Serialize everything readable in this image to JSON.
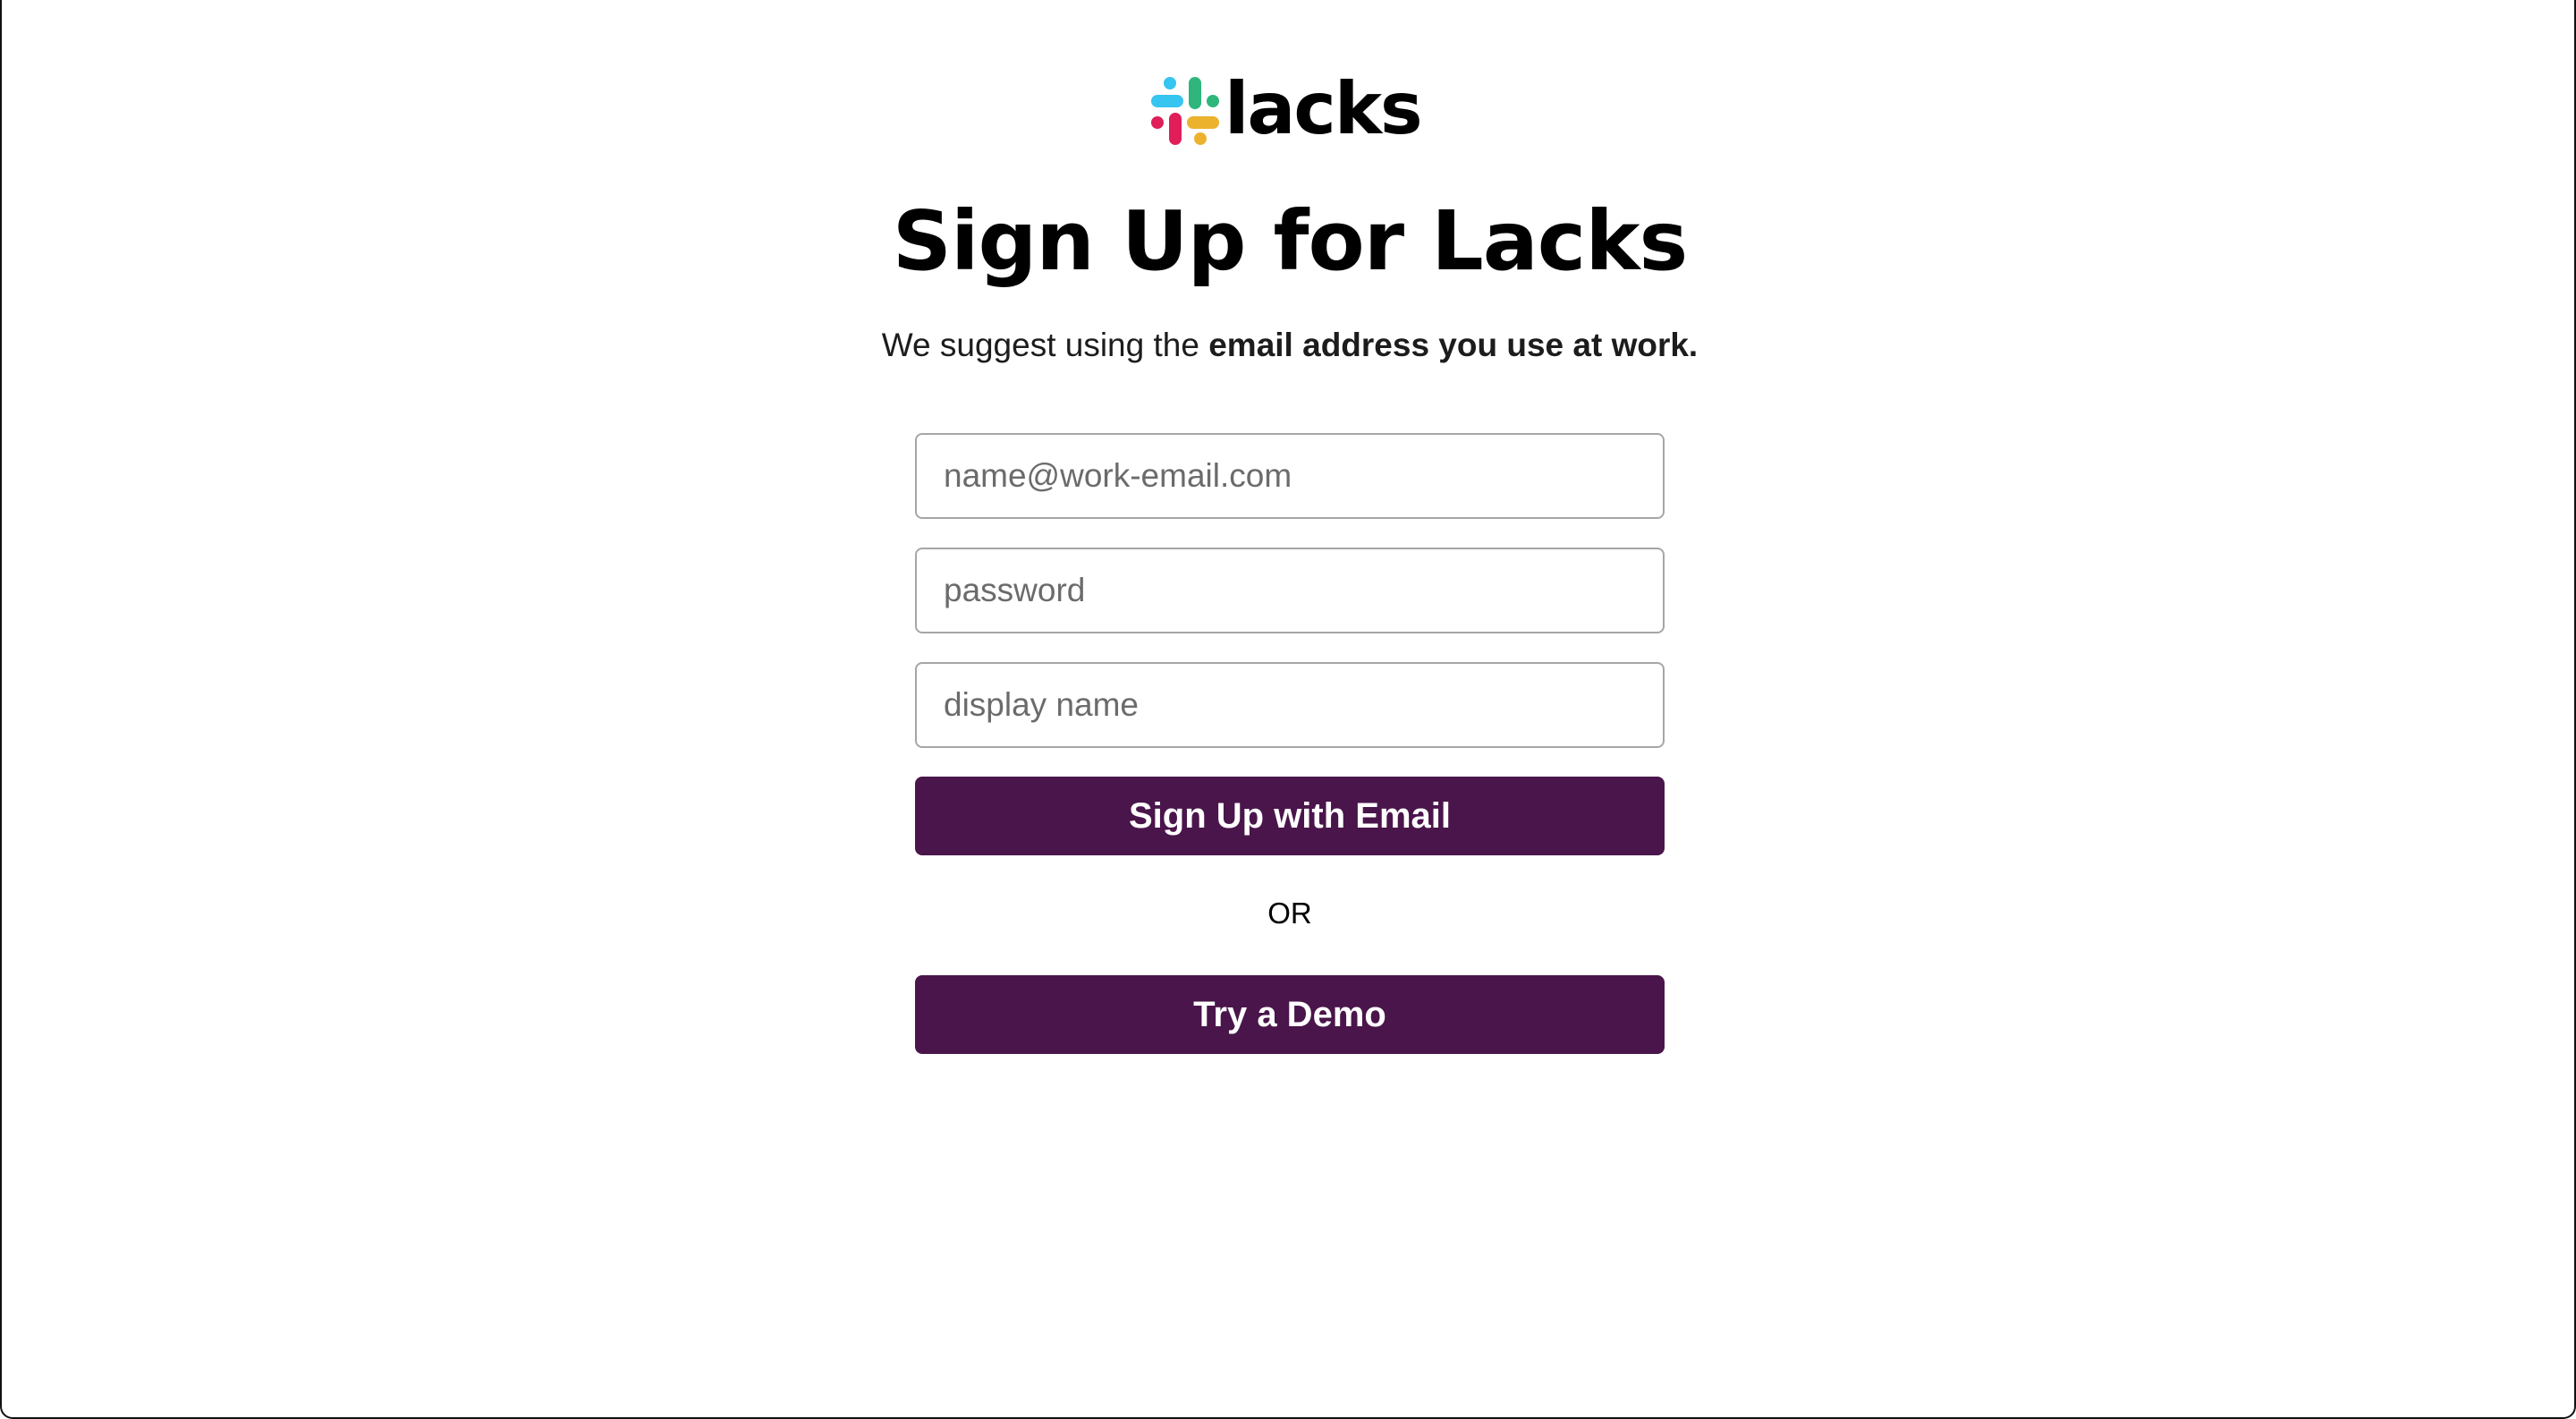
{
  "brand": {
    "wordmark": "lacks",
    "colors": {
      "blue": "#36c5f0",
      "green": "#2eb67d",
      "red": "#e01e5a",
      "yellow": "#ecb22e"
    }
  },
  "heading": "Sign Up for Lacks",
  "subtitle": {
    "prefix": "We suggest using the ",
    "emphasis": "email address you use at work."
  },
  "form": {
    "email": {
      "placeholder": "name@work-email.com",
      "value": ""
    },
    "password": {
      "placeholder": "password",
      "value": ""
    },
    "display_name": {
      "placeholder": "display name",
      "value": ""
    },
    "signup_label": "Sign Up with Email",
    "separator": "OR",
    "demo_label": "Try a Demo"
  },
  "theme": {
    "button_color": "#4a154b",
    "input_border": "#a6a6a6"
  },
  "icons": {
    "logo": "slack-hash-icon"
  }
}
